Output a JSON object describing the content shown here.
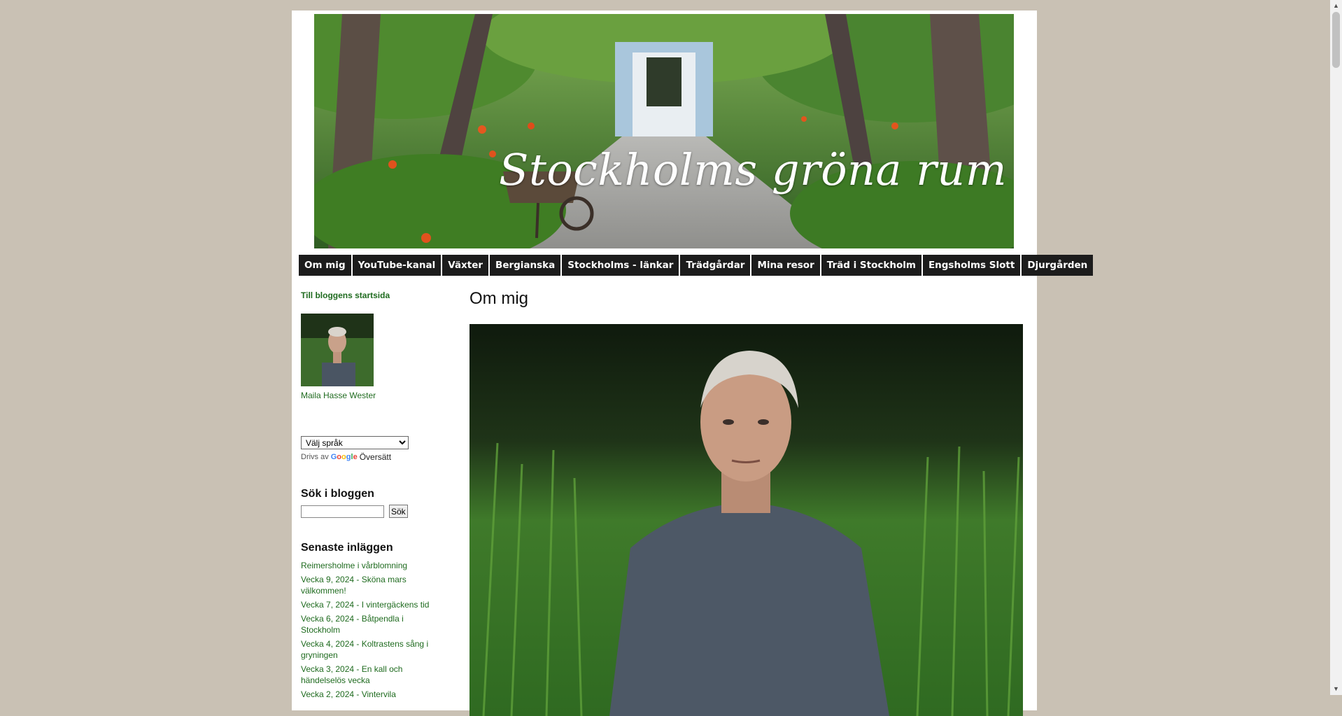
{
  "site": {
    "title": "Stockholms gröna rum"
  },
  "nav": {
    "tabs": [
      {
        "label": "Om mig"
      },
      {
        "label": "YouTube-kanal"
      },
      {
        "label": "Växter"
      },
      {
        "label": "Bergianska"
      },
      {
        "label": "Stockholms - länkar"
      },
      {
        "label": "Trädgårdar"
      },
      {
        "label": "Mina resor"
      },
      {
        "label": "Träd i Stockholm"
      },
      {
        "label": "Engsholms Slott"
      },
      {
        "label": "Djurgården"
      }
    ]
  },
  "sidebar": {
    "home_link": "Till bloggens startsida",
    "author_name": "Maila Hasse Wester",
    "language_select": "Välj språk",
    "powered_by": "Drivs av",
    "google": "Google",
    "translate": "Översätt",
    "search_title": "Sök i bloggen",
    "search_value": "",
    "search_button": "Sök",
    "recent_title": "Senaste inläggen",
    "recent_posts": [
      "Reimersholme i vårblomning",
      "Vecka 9, 2024 - Sköna mars välkommen!",
      "Vecka 7, 2024 - I vintergäckens tid",
      "Vecka 6, 2024 - Båtpendla i Stockholm",
      "Vecka 4, 2024 - Koltrastens sång i gryningen",
      "Vecka 3, 2024 - En kall och händelselös vecka",
      "Vecka 2, 2024 - Vintervila"
    ]
  },
  "main": {
    "post_title": "Om mig"
  },
  "colors": {
    "background": "#c9c1b4",
    "nav": "#1c1c1c",
    "link": "#1f6b1f"
  }
}
